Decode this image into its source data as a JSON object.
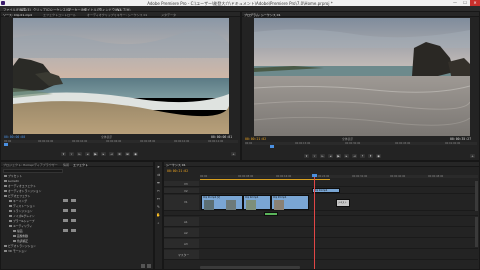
{
  "window": {
    "title": "Adobe Premiere Pro - C:\\ユーザー\\能登大介\\ドキュメント\\Adobe\\Premiere Pro\\7.0\\Home.prproj *",
    "min": "—",
    "max": "☐",
    "close": "✕"
  },
  "menu": [
    "ファイル(F)",
    "編集(E)",
    "クリップ(C)",
    "シーケンス(S)",
    "マーカー(M)",
    "タイトル(T)",
    "ウィンドウ(W)",
    "ヘルプ(H)"
  ],
  "source": {
    "tabs": [
      "ソース: Clip 01.mp4",
      "エフェクトコントロール",
      "オーディオクリップミキサー: シーケンス 01",
      "メタデータ"
    ],
    "tc_in": "00:00:00:00",
    "fit": "全体表示",
    "tc_out": "00:00:06:01",
    "ruler": [
      "00:00",
      "00:00:02:00",
      "00:00:04:00",
      "00:00:06:00",
      "00:00:08:00",
      "00:00:10:00",
      "00:00:12:00"
    ]
  },
  "program": {
    "tabs": [
      "プログラム: シーケンス 01"
    ],
    "tc_in": "00:00:21:02",
    "fit": "全体表示",
    "tc_out": "00:00:35:27",
    "ruler": [
      "00:00",
      "00:00:15:00",
      "00:00:30:00",
      "00:00:45:00",
      "00:01:00:00"
    ]
  },
  "project": {
    "tabs": [
      "プロジェクト: Home",
      "メディアブラウザー",
      "情報",
      "エフェクト"
    ],
    "items": [
      "プリセット",
      "Lumetri",
      "オーディオエフェクト",
      "オーディオトランジション",
      "ビデオエフェクト",
      "キーイング",
      "ディストーション",
      "トランジション",
      "ノイズ&グレイン",
      "ブラー&シャープ",
      "ユーティリティ",
      "描画",
      "画像制御",
      "色調補正",
      "ビデオトランジション",
      "3D モーション"
    ]
  },
  "timeline": {
    "tab": "シーケンス 01",
    "tc": "00:00:21:02",
    "ruler": [
      "00:00",
      "00:00:08:00",
      "00:00:16:00",
      "00:00:24:00",
      "00:00:32:00",
      "00:00:40:00",
      "00:00:48:00"
    ],
    "tracks": [
      "V3",
      "V2",
      "V1",
      "A1",
      "A2",
      "A3",
      "マスター"
    ],
    "clips": [
      "Clip 01.mp4 [V]",
      "Clip 02.mp4",
      "Clip 03.mp4",
      "Clip 04.mp4",
      "テキスト"
    ]
  },
  "colors": {
    "timecode_blue": "#4a8fe0",
    "timecode_orange": "#e8a020",
    "playhead": "#e14646",
    "clip_video": "#7aa6d4",
    "clip_title": "#5bb55b"
  }
}
